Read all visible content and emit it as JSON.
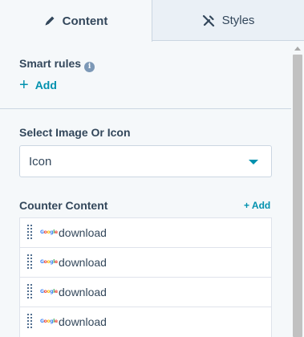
{
  "tabs": {
    "content_label": "Content",
    "styles_label": "Styles",
    "content_icon": "pencil-icon",
    "styles_icon": "styles-icon"
  },
  "smart_rules": {
    "label": "Smart rules",
    "info_icon": "info-icon",
    "add_label": "Add"
  },
  "image_or_icon": {
    "label": "Select Image Or Icon",
    "value": "Icon"
  },
  "counter_content": {
    "label": "Counter Content",
    "add_label": "+ Add",
    "items": [
      {
        "label": "download",
        "thumb": "Google"
      },
      {
        "label": "download",
        "thumb": "Google"
      },
      {
        "label": "download",
        "thumb": "Google"
      },
      {
        "label": "download",
        "thumb": "Google"
      }
    ]
  },
  "colors": {
    "accent": "#0091ae",
    "text": "#33475b",
    "tab_inactive_bg": "#eaf0f6",
    "panel_bg": "#f5f8fa"
  }
}
